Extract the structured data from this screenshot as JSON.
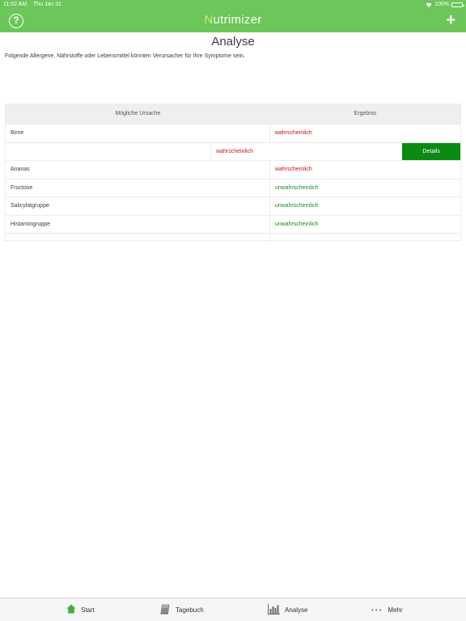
{
  "status": {
    "time": "11:02 AM",
    "date": "Thu Jan 31",
    "battery": "100%"
  },
  "nav": {
    "title_first": "N",
    "title_rest": "utrimizer",
    "help": "?",
    "add": "+"
  },
  "page": {
    "title": "Analyse",
    "intro": "Folgende Allergene, Nährstoffe oder Lebensmittel könnten Verursacher für Ihre Symptome sein."
  },
  "table": {
    "headers": [
      "Mögliche Ursache",
      "Ergebnis"
    ],
    "rows": [
      {
        "cause": "Birne",
        "result": "wahrscheinlich"
      },
      {
        "detail_result": "wahrscheinlich",
        "detail_button": "Details"
      },
      {
        "cause": "Ananas",
        "result": "wahrscheinlich"
      },
      {
        "cause": "Fructose",
        "result": "unwahrscheinlich"
      },
      {
        "cause": "Salicylatgruppe",
        "result": "unwahrscheinlich"
      },
      {
        "cause": "Histamingruppe",
        "result": "unwahrscheinlich"
      }
    ]
  },
  "tabs": {
    "start": "Start",
    "tagebuch": "Tagebuch",
    "analyse": "Analyse",
    "mehr": "Mehr"
  },
  "colors": {
    "brand": "#6cc65a",
    "likely": "#c0171c",
    "unlikely": "#1e8a1e",
    "details_button": "#0b8a12"
  }
}
